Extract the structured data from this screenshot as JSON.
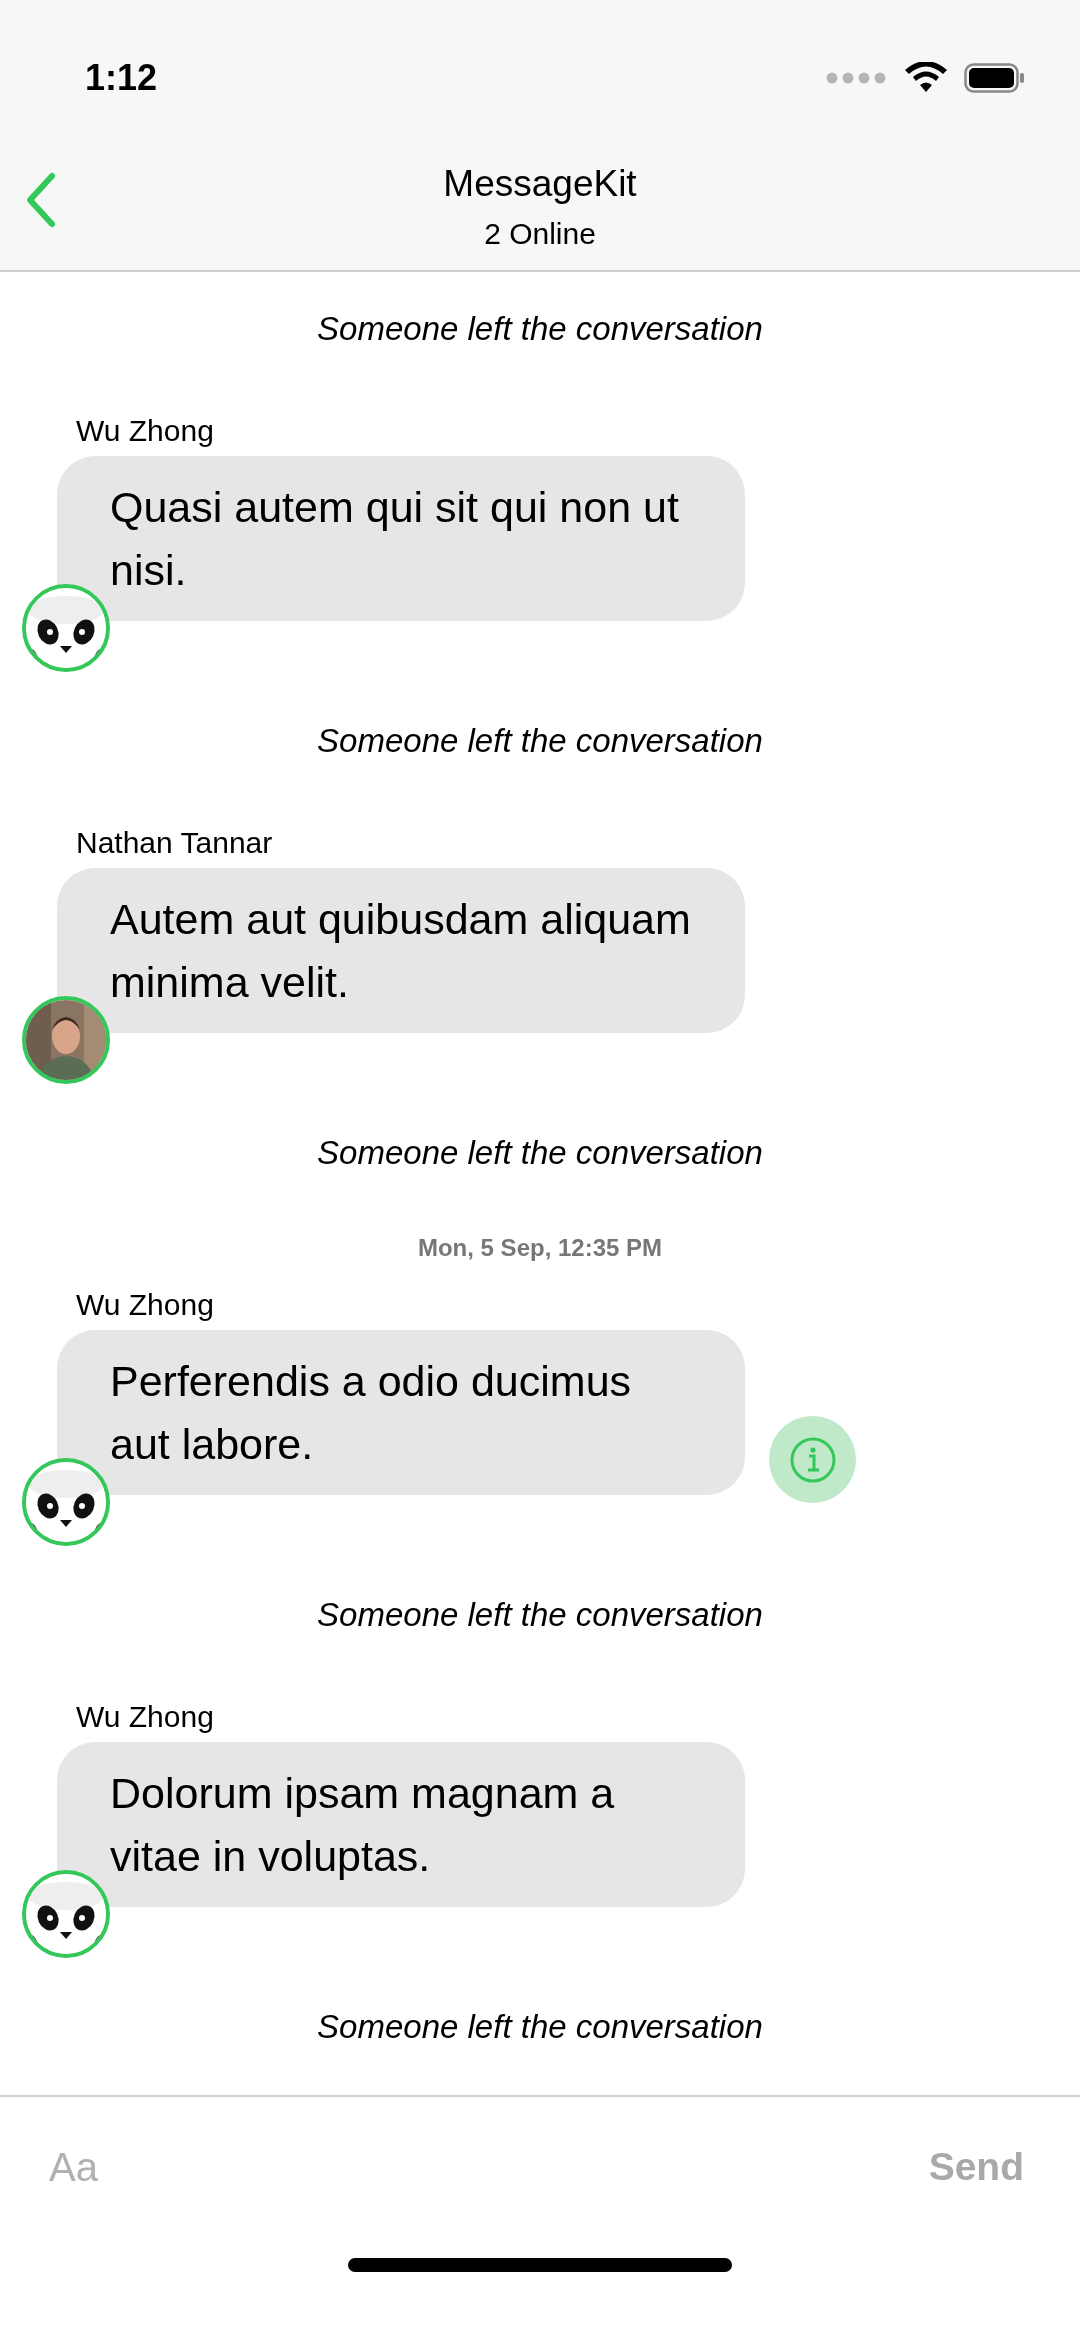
{
  "status_bar": {
    "time": "1:12"
  },
  "nav": {
    "title": "MessageKit",
    "subtitle": "2 Online"
  },
  "items": [
    {
      "kind": "system",
      "text": "Someone left the conversation"
    },
    {
      "kind": "message",
      "sender": "Wu Zhong",
      "text": "Quasi autem qui sit qui non ut nisi.",
      "avatar_photo": false,
      "info_button": false
    },
    {
      "kind": "system",
      "text": "Someone left the conversation"
    },
    {
      "kind": "message",
      "sender": "Nathan Tannar",
      "text": "Autem aut quibusdam aliquam minima velit.",
      "avatar_photo": true,
      "info_button": false
    },
    {
      "kind": "system",
      "text": "Someone left the conversation"
    },
    {
      "kind": "date",
      "text": "Mon, 5 Sep, 12:35 PM"
    },
    {
      "kind": "message",
      "sender": "Wu Zhong",
      "text": "Perferendis a odio ducimus aut labore.",
      "avatar_photo": false,
      "info_button": true
    },
    {
      "kind": "system",
      "text": "Someone left the conversation"
    },
    {
      "kind": "message",
      "sender": "Wu Zhong",
      "text": "Dolorum ipsam magnam a vitae in voluptas.",
      "avatar_photo": false,
      "info_button": false
    },
    {
      "kind": "system",
      "text": "Someone left the conversation"
    }
  ],
  "input": {
    "placeholder": "Aa",
    "send": "Send"
  }
}
